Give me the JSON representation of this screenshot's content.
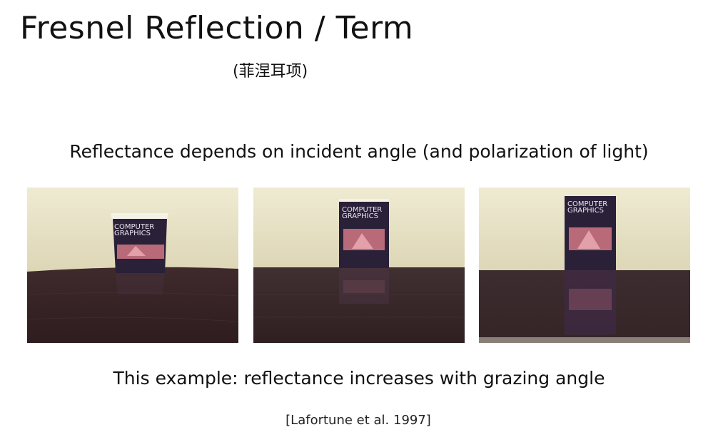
{
  "slide": {
    "title": "Fresnel Reflection / Term",
    "subtitle": "(菲涅耳项)",
    "caption_top": "Reflectance depends on incident angle (and polarization of light)",
    "caption_bottom": "This example: reflectance increases with grazing angle",
    "citation": "[Lafortune et al. 1997]"
  },
  "photos": [
    {
      "book_title_line1": "COMPUTER",
      "book_title_line2": "GRAPHICS"
    },
    {
      "book_title_line1": "COMPUTER",
      "book_title_line2": "GRAPHICS"
    },
    {
      "book_title_line1": "COMPUTER",
      "book_title_line2": "GRAPHICS"
    }
  ],
  "colors": {
    "wall": "#e9e4c8",
    "table": "#3a2424",
    "book": "#2a2038"
  }
}
